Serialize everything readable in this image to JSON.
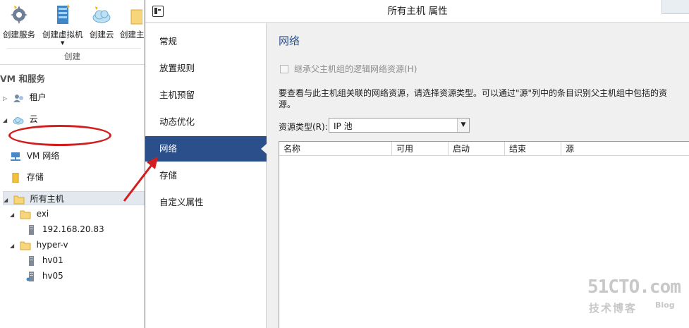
{
  "ribbon": {
    "buttons": [
      {
        "label": "创建服务",
        "icon": "service-gear-icon"
      },
      {
        "label": "创建虚拟机",
        "icon": "vm-stack-icon",
        "dropdown": "▼"
      },
      {
        "label": "创建云",
        "icon": "cloud-icon"
      },
      {
        "label": "创建主",
        "icon": "host-group-folder-icon"
      }
    ],
    "group_label": "创建"
  },
  "tree": {
    "header": "VM 和服务",
    "nodes": [
      {
        "label": "租户",
        "icon": "tenant-icon",
        "expander": "▷"
      },
      {
        "label": "云",
        "icon": "cloud-icon",
        "expander": "◢"
      },
      {
        "label": "VM 网络",
        "icon": "vm-network-icon"
      },
      {
        "label": "存储",
        "icon": "storage-icon"
      },
      {
        "label": "所有主机",
        "icon": "folder-icon",
        "expander": "◢"
      },
      {
        "label": "exi",
        "icon": "folder-icon",
        "expander": "◢"
      },
      {
        "label": "192.168.20.83",
        "icon": "server-icon"
      },
      {
        "label": "hyper-v",
        "icon": "folder-icon",
        "expander": "◢"
      },
      {
        "label": "hv01",
        "icon": "server-icon"
      },
      {
        "label": "hv05",
        "icon": "server-icon"
      }
    ]
  },
  "dialog": {
    "title": "所有主机 属性",
    "nav": [
      "常规",
      "放置规则",
      "主机预留",
      "动态优化",
      "网络",
      "存储",
      "自定义属性"
    ],
    "active_nav": "网络",
    "section_title": "网络",
    "inherit_label": "继承父主机组的逻辑网络资源(H)",
    "inherit_checked": false,
    "description": "要查看与此主机组关联的网络资源，请选择资源类型。可以通过\"源\"列中的条目识别父主机组中包括的资源。",
    "resource_type_label": "资源类型(R):",
    "resource_type_value": "IP 池",
    "grid_columns": [
      "名称",
      "可用",
      "启动",
      "结束",
      "源"
    ]
  },
  "watermark": {
    "main": "51CTO.com",
    "sub": "技术博客",
    "blog": "Blog"
  },
  "colors": {
    "nav_active": "#2b4f8a",
    "annotation_red": "#d21e1e",
    "section_title": "#2b4f8a"
  }
}
